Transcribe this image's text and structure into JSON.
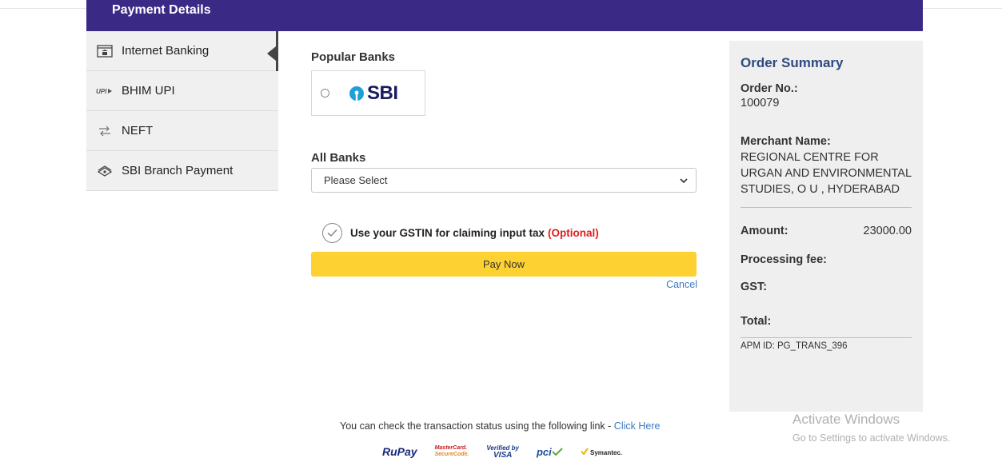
{
  "header": {
    "title": "Payment Details"
  },
  "sidebar": {
    "items": [
      {
        "label": "Internet Banking",
        "icon": "bank-icon",
        "active": true
      },
      {
        "label": "BHIM UPI",
        "icon": "upi-icon",
        "active": false
      },
      {
        "label": "NEFT",
        "icon": "transfer-icon",
        "active": false
      },
      {
        "label": "SBI Branch Payment",
        "icon": "cash-icon",
        "active": false
      }
    ]
  },
  "main": {
    "popular_banks_label": "Popular Banks",
    "popular_bank": {
      "name": "SBI",
      "selected": false
    },
    "all_banks_label": "All Banks",
    "all_banks_select": {
      "value": "Please Select"
    },
    "gstin": {
      "text": "Use your GSTIN for claiming input tax",
      "optional": "(Optional)"
    },
    "pay_button": "Pay Now",
    "cancel_link": "Cancel"
  },
  "summary": {
    "title": "Order Summary",
    "order_no_label": "Order No.:",
    "order_no": "100079",
    "merchant_label": "Merchant Name:",
    "merchant_name": "REGIONAL CENTRE FOR URGAN AND ENVIRONMENTAL STUDIES, O U , HYDERABAD",
    "amount_label": "Amount:",
    "amount": "23000.00",
    "processing_fee_label": "Processing fee:",
    "gst_label": "GST:",
    "total_label": "Total:",
    "apm_id": "APM ID: PG_TRANS_396"
  },
  "footer": {
    "status_text": "You can check the transaction status using the following link - ",
    "status_link": "Click Here",
    "logos": {
      "rupay": "RuPay",
      "mastercard_line1": "MasterCard.",
      "mastercard_line2": "SecureCode.",
      "visa_line1": "Verified by",
      "visa_line2": "VISA",
      "pci": "pci",
      "symantec": "Symantec."
    }
  },
  "watermark": {
    "title": "Activate Windows",
    "subtitle": "Go to Settings to activate Windows."
  },
  "colors": {
    "header": "#3a2a86",
    "pay_button": "#fdd131",
    "link": "#3b7bc2",
    "optional": "#e01c1c",
    "summary_title": "#2e4a82"
  }
}
